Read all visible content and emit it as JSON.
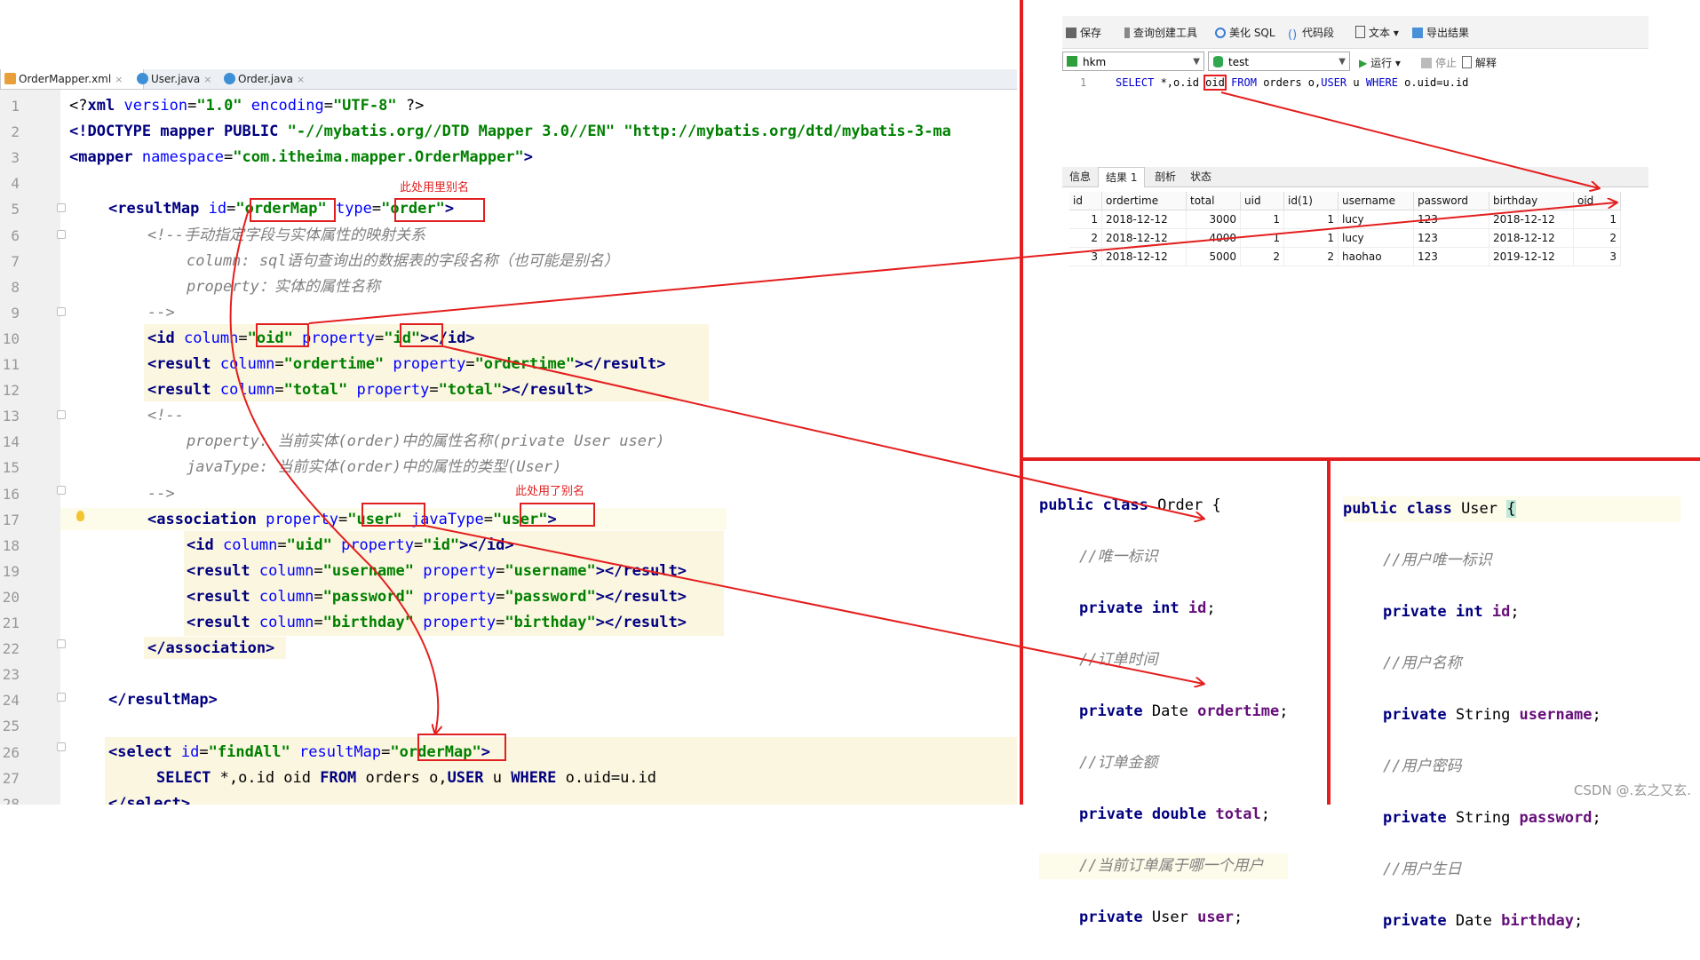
{
  "ide": {
    "tabs": [
      {
        "label": "OrderMapper.xml",
        "active": true,
        "icon": "xml-file-icon"
      },
      {
        "label": "User.java",
        "active": false,
        "icon": "java-class-icon"
      },
      {
        "label": "Order.java",
        "active": false,
        "icon": "java-class-icon"
      }
    ],
    "close_glyph": "×",
    "line_numbers": [
      "1",
      "2",
      "3",
      "4",
      "5",
      "6",
      "7",
      "8",
      "9",
      "10",
      "11",
      "12",
      "13",
      "14",
      "15",
      "16",
      "17",
      "18",
      "19",
      "20",
      "21",
      "22",
      "23",
      "24",
      "25",
      "26",
      "27",
      "28"
    ],
    "annotations": {
      "alias_note_1": "此处用里别名",
      "alias_note_2": "此处用了别名"
    }
  },
  "sql_tool": {
    "toolbar": {
      "save": "保存",
      "query_builder": "查询创建工具",
      "beautify": "美化 SQL",
      "snippet": "代码段",
      "text": "文本",
      "export": "导出结果",
      "run": "运行",
      "stop": "停止",
      "explain": "解释"
    },
    "connection": "hkm",
    "database": "test",
    "editor_line_no": "1",
    "query": {
      "p1": "SELECT",
      "p2": " *,o.id ",
      "p3": "oid",
      "p4": " FROM",
      "p5": " orders o,",
      "p6": "USER",
      "p7": " u ",
      "p8": "WHERE",
      "p9": " o.uid=u.id"
    },
    "result_tabs": [
      "信息",
      "结果 1",
      "剖析",
      "状态"
    ],
    "columns": [
      "id",
      "ordertime",
      "total",
      "uid",
      "id(1)",
      "username",
      "password",
      "birthday",
      "oid"
    ],
    "rows": [
      [
        "1",
        "2018-12-12",
        "3000",
        "1",
        "1",
        "lucy",
        "123",
        "2018-12-12",
        "1"
      ],
      [
        "2",
        "2018-12-12",
        "4000",
        "1",
        "1",
        "lucy",
        "123",
        "2018-12-12",
        "2"
      ],
      [
        "3",
        "2018-12-12",
        "5000",
        "2",
        "2",
        "haohao",
        "123",
        "2019-12-12",
        "3"
      ]
    ]
  },
  "order_class": {
    "header_kw": "public class",
    "header_name": " Order {",
    "c1": "//唯一标识",
    "f1_kw": "private int",
    "f1_name": "id",
    "c2": "//订单时间",
    "f2_kw": "private",
    "f2_type": " Date ",
    "f2_name": "ordertime",
    "c3": "//订单金额",
    "f3_kw": "private double",
    "f3_name": "total",
    "c4": "//当前订单属于哪一个用户",
    "f4_kw": "private",
    "f4_type": " User ",
    "f4_name": "user"
  },
  "user_class": {
    "header_kw": "public class",
    "header_name": " User ",
    "brace": "{",
    "c1": "//用户唯一标识",
    "f1_kw": "private int",
    "f1_name": "id",
    "c2": "//用户名称",
    "f2_kw": "private",
    "f2_type": " String ",
    "f2_name": "username",
    "c3": "//用户密码",
    "f3_kw": "private",
    "f3_type": " String ",
    "f3_name": "password",
    "c4": "//用户生日",
    "f4_kw": "private",
    "f4_type": " Date ",
    "f4_name": "birthday"
  },
  "watermark": "CSDN @.玄之又玄.",
  "colors": {
    "annotation_red": "#e41e1e",
    "xml_tag": "#000080",
    "xml_attr": "#0000ff",
    "xml_value": "#008000",
    "comment": "#808080",
    "java_field": "#660e7a"
  }
}
